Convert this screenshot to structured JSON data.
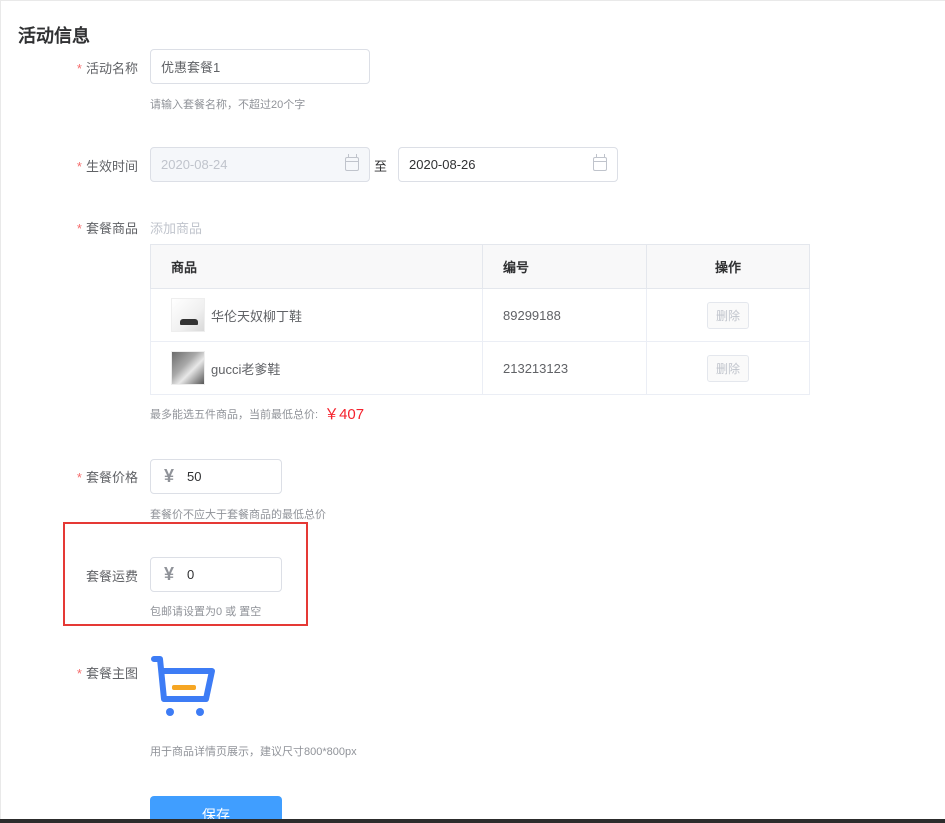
{
  "section": {
    "title": "活动信息"
  },
  "fields": {
    "name": {
      "label": "活动名称",
      "value": "优惠套餐1",
      "hint": "请输入套餐名称，不超过20个字"
    },
    "time": {
      "label": "生效时间",
      "start": "2020-08-24",
      "separator": "至",
      "end": "2020-08-26"
    },
    "goods": {
      "label": "套餐商品",
      "add_link": "添加商品",
      "columns": [
        "商品",
        "编号",
        "操作"
      ],
      "rows": [
        {
          "name": "华伦天奴柳丁鞋",
          "code": "89299188",
          "action": "删除"
        },
        {
          "name": "gucci老爹鞋",
          "code": "213213123",
          "action": "删除"
        }
      ],
      "hint": "最多能选五件商品，当前最低总价:",
      "min_total": "￥407"
    },
    "price": {
      "label": "套餐价格",
      "currency": "¥",
      "value": "50",
      "hint": "套餐价不应大于套餐商品的最低总价"
    },
    "shipping": {
      "label": "套餐运费",
      "currency": "¥",
      "value": "0",
      "hint": "包邮请设置为0 或 置空"
    },
    "image": {
      "label": "套餐主图",
      "icon": "shopping-cart-icon",
      "hint": "用于商品详情页展示，建议尺寸800*800px"
    }
  },
  "actions": {
    "save_label": "保存"
  },
  "colors": {
    "required": "#f56c6c",
    "accent": "#409eff",
    "price": "#f5222d",
    "highlight": "#e53935",
    "cart_blue": "#3d7cf5",
    "cart_orange": "#f6a623"
  }
}
